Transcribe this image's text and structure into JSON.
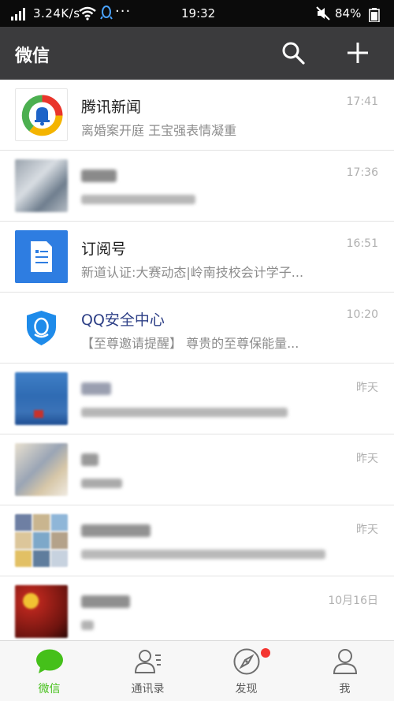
{
  "status_bar": {
    "net_speed": "3.24K/s",
    "more": "···",
    "time": "19:32",
    "battery": "84%"
  },
  "top_bar": {
    "title": "微信"
  },
  "chats": [
    {
      "name": "腾讯新闻",
      "preview": "离婚案开庭 王宝强表情凝重",
      "time": "17:41",
      "avatar": "tencent-news-logo",
      "blurred": false
    },
    {
      "name": "",
      "preview": "",
      "time": "17:36",
      "avatar": "blurred-photo",
      "blurred": true
    },
    {
      "name": "订阅号",
      "preview": "新道认证:大赛动态|岭南技校会计学子...",
      "time": "16:51",
      "avatar": "subscription-icon",
      "blurred": false
    },
    {
      "name": "QQ安全中心",
      "preview": "【至尊邀请提醒】 尊贵的至尊保能量...",
      "time": "10:20",
      "avatar": "qq-security-icon",
      "blurred": false
    },
    {
      "name": "",
      "preview": "",
      "time": "昨天",
      "avatar": "blurred-photo",
      "blurred": true
    },
    {
      "name": "",
      "preview": "",
      "time": "昨天",
      "avatar": "blurred-photo",
      "blurred": true
    },
    {
      "name": "",
      "preview": "",
      "time": "昨天",
      "avatar": "blurred-photo",
      "blurred": true
    },
    {
      "name": "",
      "preview": "",
      "time": "10月16日",
      "avatar": "blurred-photo",
      "blurred": true
    }
  ],
  "tabs": [
    {
      "label": "微信",
      "icon": "chat-bubble-icon",
      "active": true
    },
    {
      "label": "通讯录",
      "icon": "contacts-icon",
      "active": false
    },
    {
      "label": "发现",
      "icon": "compass-icon",
      "active": false
    },
    {
      "label": "我",
      "icon": "person-icon",
      "active": false
    }
  ],
  "colors": {
    "topbar": "#3b3b3d",
    "accent": "#45c01a",
    "badge": "#f43530"
  }
}
